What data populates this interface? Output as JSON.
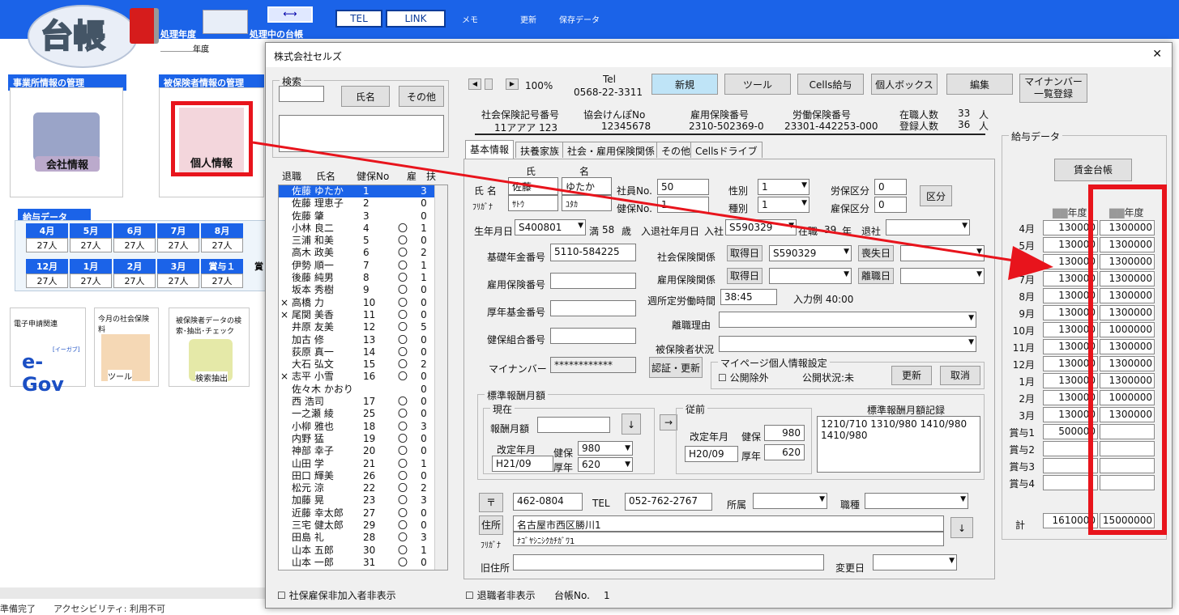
{
  "app": {
    "logo_text": "台帳",
    "year_label": "処理年度",
    "ledger_label": "処理中の台帳",
    "year_suffix": "年度",
    "tel_btn": "TEL",
    "link_btn": "LINK",
    "memo": "メモ",
    "update": "更新",
    "saved": "保存データ"
  },
  "sections": {
    "office": "事業所情報の管理",
    "insured": "被保険者情報の管理",
    "company_btn": "会社情報",
    "person_btn": "個人情報",
    "salary_title": "給与データ"
  },
  "months_row1": [
    "4月",
    "5月",
    "6月",
    "7月",
    "8月"
  ],
  "months_row2": [
    "12月",
    "1月",
    "2月",
    "3月",
    "賞与１"
  ],
  "month_val": "27人",
  "more_row1": "",
  "more_row2": "賞",
  "bottom_cards": {
    "egov_title": "電子申請関連",
    "egov_logo": "e-Gov",
    "egov_sub": "[イーガブ]",
    "tool_title": "今月の社会保険料",
    "tool_label": "ツール",
    "search_title": "被保険者データの検索･抽出･チェック",
    "search_label": "検索抽出"
  },
  "statusbar": {
    "ready": "準備完了",
    "access": "アクセシビリティ: 利用不可"
  },
  "window": {
    "title": "株式会社セルズ",
    "close": "✕"
  },
  "search": {
    "group": "検索",
    "name_btn": "氏名",
    "other_btn": "その他"
  },
  "list_headers": [
    "退職",
    "氏名",
    "健保No",
    "雇",
    "扶"
  ],
  "employees": [
    [
      "",
      "佐藤 ゆたか",
      "1",
      "",
      "3"
    ],
    [
      "",
      "佐藤 理恵子",
      "2",
      "",
      "0"
    ],
    [
      "",
      "佐藤 肇",
      "3",
      "",
      "0"
    ],
    [
      "",
      "小林 良二",
      "4",
      "〇",
      "1"
    ],
    [
      "",
      "三浦 和美",
      "5",
      "〇",
      "0"
    ],
    [
      "",
      "高木 政美",
      "6",
      "〇",
      "2"
    ],
    [
      "",
      "伊勢 順一",
      "7",
      "〇",
      "1"
    ],
    [
      "",
      "後藤 純男",
      "8",
      "〇",
      "1"
    ],
    [
      "",
      "坂本 秀樹",
      "9",
      "〇",
      "0"
    ],
    [
      "×",
      "高橋 力",
      "10",
      "〇",
      "0"
    ],
    [
      "×",
      "尾関 美香",
      "11",
      "〇",
      "0"
    ],
    [
      "",
      "井原 友美",
      "12",
      "〇",
      "5"
    ],
    [
      "",
      "加古 修",
      "13",
      "〇",
      "0"
    ],
    [
      "",
      "荻原 真一",
      "14",
      "〇",
      "0"
    ],
    [
      "",
      "大石 弘文",
      "15",
      "〇",
      "2"
    ],
    [
      "×",
      "志平 小雪",
      "16",
      "〇",
      "0"
    ],
    [
      "",
      "佐々木 かおり",
      "",
      "",
      "0"
    ],
    [
      "",
      "西 浩司",
      "17",
      "〇",
      "0"
    ],
    [
      "",
      "一之瀬 綾",
      "25",
      "〇",
      "0"
    ],
    [
      "",
      "小柳 雅也",
      "18",
      "〇",
      "3"
    ],
    [
      "",
      "内野 猛",
      "19",
      "〇",
      "0"
    ],
    [
      "",
      "神部 幸子",
      "20",
      "〇",
      "0"
    ],
    [
      "",
      "山田 学",
      "21",
      "〇",
      "1"
    ],
    [
      "",
      "田口 輝美",
      "26",
      "〇",
      "0"
    ],
    [
      "",
      "松元 涼",
      "22",
      "〇",
      "2"
    ],
    [
      "",
      "加藤 晃",
      "23",
      "〇",
      "3"
    ],
    [
      "",
      "近藤 幸太郎",
      "27",
      "〇",
      "0"
    ],
    [
      "",
      "三宅 健太郎",
      "29",
      "〇",
      "0"
    ],
    [
      "",
      "田島 礼",
      "28",
      "〇",
      "3"
    ],
    [
      "",
      "山本 五郎",
      "30",
      "〇",
      "1"
    ],
    [
      "",
      "山本 一郎",
      "31",
      "〇",
      "0"
    ]
  ],
  "footer": {
    "hide_unins": "社保雇保非加入者非表示",
    "hide_ret": "退職者非表示",
    "ledger_no_label": "台帳No.",
    "ledger_no": "1"
  },
  "toolbar": {
    "zoom": "100%",
    "tel_label": "Tel",
    "tel": "0568-22-3311",
    "new": "新規",
    "tool": "ツール",
    "cells_pay": "Cells給与",
    "personal_box": "個人ボックス",
    "edit": "編集",
    "mynumber_list": "マイナンバー 一覧登録"
  },
  "insurance": {
    "h1": "社会保険記号番号",
    "v1": "11アアア 123",
    "h2": "協会けんぽNo",
    "v2": "12345678",
    "h3": "雇用保険番号",
    "v3": "2310-502369-0",
    "h4": "労働保険番号",
    "v4": "23301-442253-000",
    "h5": "在職人数",
    "v5": "33",
    "h6": "登録人数",
    "v6": "36",
    "unit": "人"
  },
  "tabs": [
    "基本情報",
    "扶養家族",
    "社会・雇用保険関係",
    "その他",
    "Cellsドライブ"
  ],
  "form": {
    "shi": "氏",
    "mei": "名",
    "name_lbl": "氏 名",
    "furi_lbl": "ﾌﾘｶﾞﾅ",
    "last": "佐藤",
    "first": "ゆたか",
    "last_k": "ｻﾄｳ",
    "first_k": "ﾕﾀｶ",
    "emp_no_lbl": "社員No.",
    "emp_no": "50",
    "kenpo_lbl": "健保No.",
    "kenpo": "1",
    "sex_lbl": "性別",
    "sex": "1",
    "kind_lbl": "種別",
    "kind": "1",
    "rouho_lbl": "労保区分",
    "rouho": "0",
    "koho_lbl": "雇保区分",
    "koho": "0",
    "kubun_btn": "区分",
    "birth_lbl": "生年月日",
    "birth": "S400801",
    "age_pre": "満",
    "age": "58",
    "age_unit": "歳",
    "join_lbl": "入退社年月日",
    "join_pre": "入社",
    "join": "S590329",
    "tenure_pre": "在職",
    "tenure": "39",
    "tenure_unit": "年",
    "leave_pre": "退社",
    "pension_lbl": "基礎年金番号",
    "pension": "5110-584225",
    "emp_ins_lbl": "雇用保険番号",
    "kousei_lbl": "厚年基金番号",
    "kenkou_lbl": "健保組合番号",
    "mynum_lbl": "マイナンバー",
    "mynum": "************",
    "auth_btn": "認証・更新",
    "shaho_lbl": "社会保険関係",
    "acq_btn": "取得日",
    "shaho_date": "S590329",
    "loss_btn": "喪失日",
    "koyo_lbl": "雇用保険関係",
    "acq_btn2": "取得日",
    "leave_btn": "離職日",
    "weekly_lbl": "週所定労働時間",
    "weekly": "38:45",
    "weekly_ex": "入力例 40:00",
    "reason_lbl": "離職理由",
    "status_lbl": "被保険者状況",
    "mypage_grp": "マイページ個人情報設定",
    "publish_chk": "公開除外",
    "pub_status": "公開状況:未",
    "update_btn": "更新",
    "cancel_btn": "取消",
    "std_grp": "標準報酬月額",
    "current_grp": "現在",
    "monthly_lbl": "報酬月額",
    "rev_lbl": "改定年月",
    "rev": "H21/09",
    "kenpo2": "健保",
    "kenpo_val": "980",
    "kounen": "厚年",
    "kounen_val": "620",
    "prev_grp": "従前",
    "prev_rev": "H20/09",
    "prev_kenpo": "980",
    "prev_kounen": "620",
    "record_lbl": "標準報酬月額記録",
    "record": "1210/710  1310/980 1410/980 1410/980",
    "zip_btn": "〒",
    "zip": "462-0804",
    "tel_lbl": "TEL",
    "tel": "052-762-2767",
    "dept_lbl": "所属",
    "job_lbl": "職種",
    "addr_btn": "住所",
    "addr": "名古屋市西区勝川1",
    "addr_k": "ﾅｺﾞﾔｼﾆｼｸｶﾁｶﾞﾜ1",
    "furi2": "ﾌﾘｶﾞﾅ",
    "old_addr_lbl": "旧住所",
    "change_lbl": "変更日"
  },
  "salary": {
    "group": "給与データ",
    "ledger_btn": "賃金台帳",
    "year_col": "年度",
    "rows": [
      [
        "4月",
        "130000",
        "1300000"
      ],
      [
        "5月",
        "130000",
        "1300000"
      ],
      [
        "6月",
        "130000",
        "1300000"
      ],
      [
        "7月",
        "130000",
        "1300000"
      ],
      [
        "8月",
        "130000",
        "1300000"
      ],
      [
        "9月",
        "130000",
        "1300000"
      ],
      [
        "10月",
        "130000",
        "1000000"
      ],
      [
        "11月",
        "130000",
        "1300000"
      ],
      [
        "12月",
        "130000",
        "1300000"
      ],
      [
        "1月",
        "130000",
        "1300000"
      ],
      [
        "2月",
        "130000",
        "1000000"
      ],
      [
        "3月",
        "130000",
        "1300000"
      ],
      [
        "賞与1",
        "500000",
        ""
      ],
      [
        "賞与2",
        "",
        ""
      ],
      [
        "賞与3",
        "",
        ""
      ],
      [
        "賞与4",
        "",
        ""
      ]
    ],
    "total_lbl": "計",
    "total1": "1610000",
    "total2": "15000000"
  }
}
